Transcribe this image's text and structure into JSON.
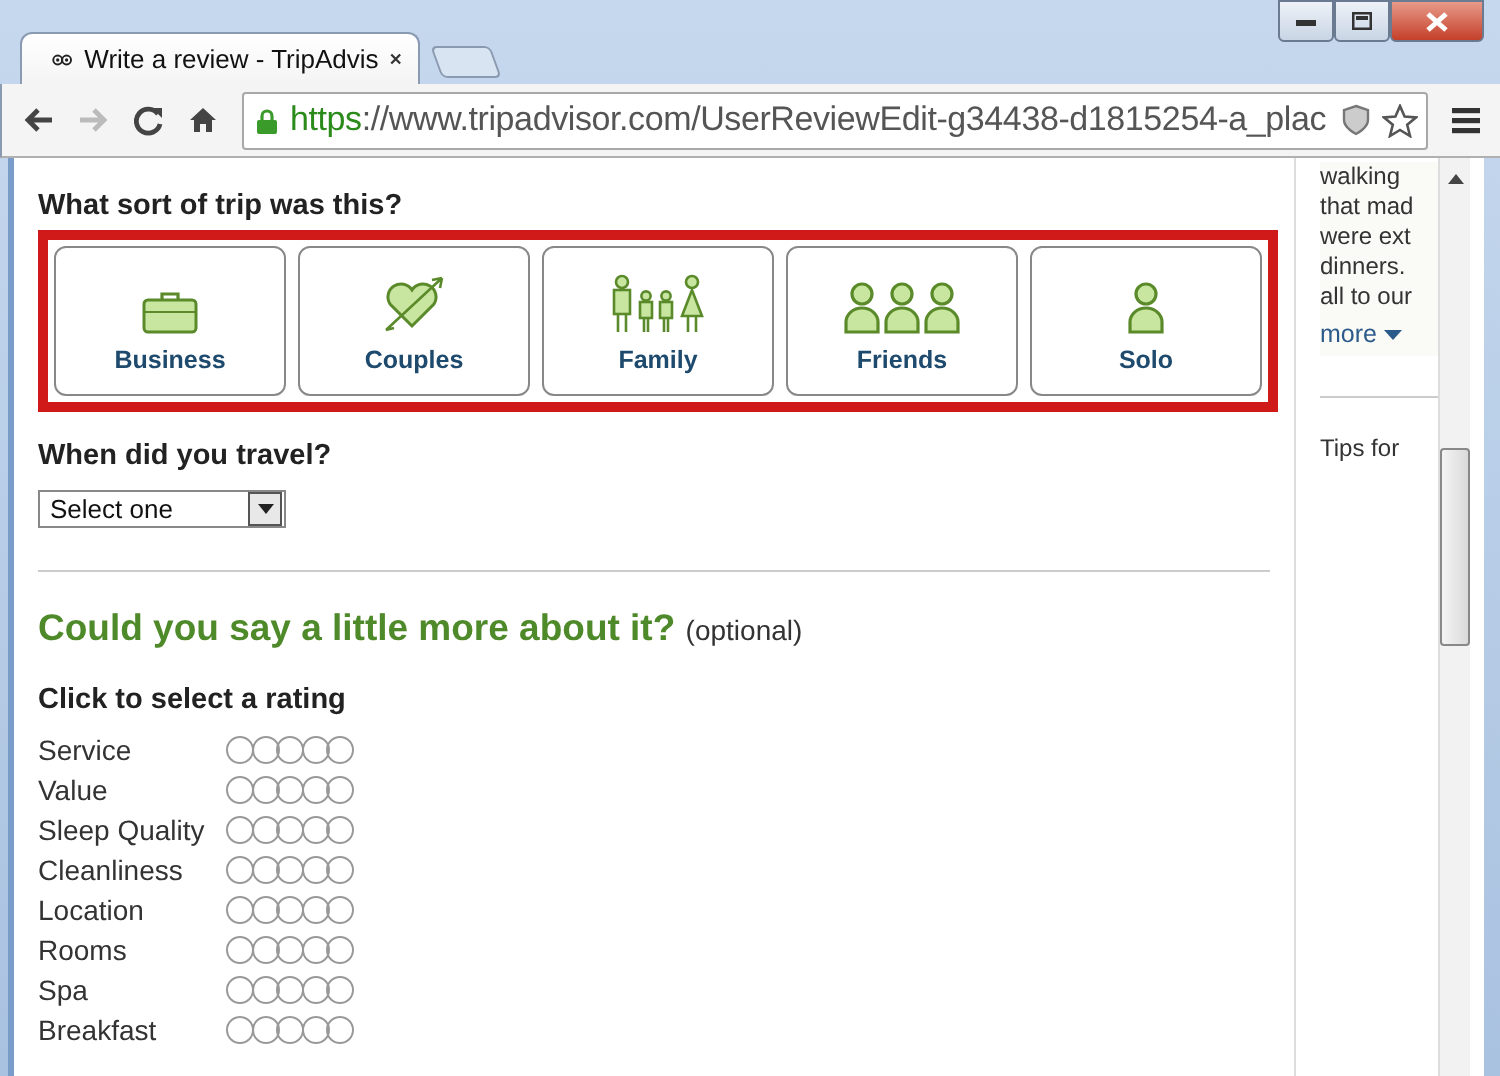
{
  "browser": {
    "tab_title": "Write a review - TripAdvis",
    "url_scheme": "https",
    "url_rest": "://www.tripadvisor.com/UserReviewEdit-g34438-d1815254-a_plac"
  },
  "trip_type": {
    "question": "What sort of trip was this?",
    "options": [
      {
        "label": "Business",
        "kind": "business",
        "selected": false
      },
      {
        "label": "Couples",
        "kind": "couples",
        "selected": false
      },
      {
        "label": "Family",
        "kind": "family",
        "selected": false
      },
      {
        "label": "Friends",
        "kind": "friends",
        "selected": false
      },
      {
        "label": "Solo",
        "kind": "solo",
        "selected": false
      }
    ]
  },
  "travel_date": {
    "question": "When did you travel?",
    "value": "Select one"
  },
  "more": {
    "heading": "Could you say a little more about it?",
    "note": "(optional)",
    "prompt": "Click to select a rating",
    "ratings": [
      {
        "label": "Service",
        "stars": 0
      },
      {
        "label": "Value",
        "stars": 0
      },
      {
        "label": "Sleep Quality",
        "stars": 0
      },
      {
        "label": "Cleanliness",
        "stars": 0
      },
      {
        "label": "Location",
        "stars": 0
      },
      {
        "label": "Rooms",
        "stars": 0
      },
      {
        "label": "Spa",
        "stars": 0
      },
      {
        "label": "Breakfast",
        "stars": 0
      }
    ]
  },
  "sidebar": {
    "lines": [
      "walking",
      "that mad",
      "were ext",
      "dinners.",
      "all to our"
    ],
    "more_link": "more",
    "tips": "Tips for"
  }
}
